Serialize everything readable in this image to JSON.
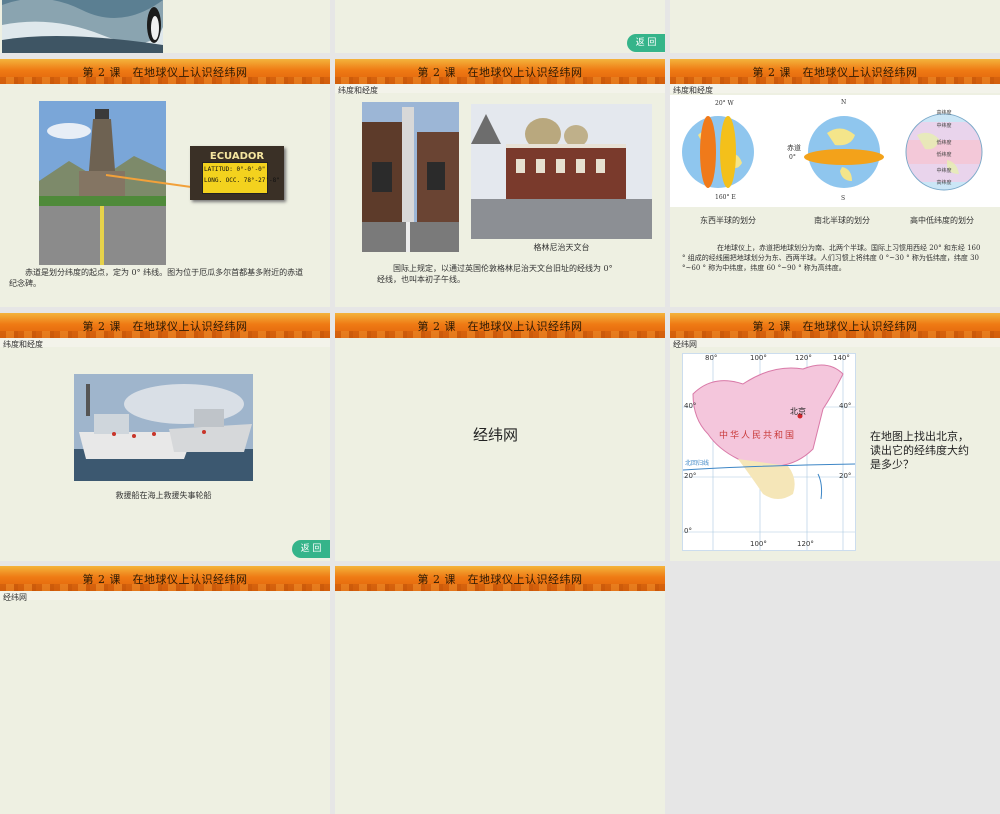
{
  "lesson_title": "第 2 课　在地球仪上认识经纬网",
  "back_label": "返 回",
  "slides": {
    "s4": {
      "caption": "赤道是划分纬度的起点，定为 0° 纬线。图为位于厄瓜多尔首都基多附近的赤道纪念碑。",
      "sign_country": "ECUADOR",
      "sign_lat": "LATITUD: 0°-0'-0\"",
      "sign_long": "LONG. OCC. 78°-27'-8\""
    },
    "s5": {
      "subtitle": "纬度和经度",
      "photo_caption": "格林尼治天文台",
      "caption": "国际上规定，以通过英国伦敦格林尼治天文台旧址的经线为 0° 经线，也叫本初子午线。"
    },
    "s6": {
      "subtitle": "纬度和经度",
      "globe1": {
        "caption": "东西半球的划分",
        "label_top": "20° W",
        "label_bottom": "160° E"
      },
      "globe2": {
        "caption": "南北半球的划分",
        "label_n": "N",
        "label_s": "S",
        "label_eq": "赤道",
        "label_zero": "0°"
      },
      "globe3": {
        "caption": "高中低纬度的划分",
        "bands": [
          "高纬度",
          "中纬度",
          "低纬度",
          "低纬度",
          "中纬度",
          "高纬度"
        ]
      },
      "text": "在地球仪上，赤道把地球划分为南、北两个半球。国际上习惯用西经 20° 和东经 160 ° 组成的经线圈把地球划分为东、西两半球。人们习惯上将纬度 0 °~30 ° 称为低纬度，纬度 30 °~60 ° 称为中纬度，纬度 60 °~90 ° 称为高纬度。"
    },
    "s7": {
      "subtitle": "纬度和经度",
      "caption": "救援船在海上救援失事轮船"
    },
    "s8": {
      "heading": "经纬网"
    },
    "s9": {
      "subtitle": "经纬网",
      "map": {
        "beijing": "北京",
        "country": "中华人民共和国",
        "tropic": "北回归线",
        "lon_top": [
          "80°",
          "100°",
          "120°",
          "140°"
        ],
        "lon_bottom": [
          "100°",
          "120°"
        ],
        "lat_left": [
          "40°",
          "20°",
          "0°"
        ],
        "lat_right": [
          "40°",
          "20°"
        ]
      },
      "question": "在地图上找出北京，读出它的经纬度大约是多少？"
    },
    "s10": {
      "subtitle": "经纬网"
    }
  },
  "colors": {
    "banner_top": "#f4b43c",
    "banner_bottom": "#e0620a",
    "slide_bg": "#eef0e2",
    "back_button": "#35b48a"
  }
}
